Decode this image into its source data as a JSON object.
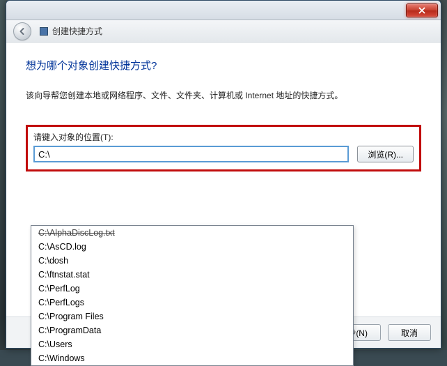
{
  "titlebar": {
    "close_label": "x"
  },
  "nav": {
    "title": "创建快捷方式"
  },
  "content": {
    "heading": "想为哪个对象创建快捷方式?",
    "description": "该向导帮您创建本地或网络程序、文件、文件夹、计算机或 Internet 地址的快捷方式。",
    "location_label": "请键入对象的位置(T):",
    "path_value": "C:\\",
    "browse_label": "浏览(R)..."
  },
  "dropdown": {
    "items": [
      "C:\\AlphaDiscLog.txt",
      "C:\\AsCD.log",
      "C:\\dosh",
      "C:\\ftnstat.stat",
      "C:\\PerfLog",
      "C:\\PerfLogs",
      "C:\\Program Files",
      "C:\\ProgramData",
      "C:\\Users",
      "C:\\Windows"
    ]
  },
  "footer": {
    "next_label": "下一步(N)",
    "cancel_label": "取消"
  },
  "colors": {
    "highlight": "#c10c0c",
    "heading": "#003399"
  }
}
